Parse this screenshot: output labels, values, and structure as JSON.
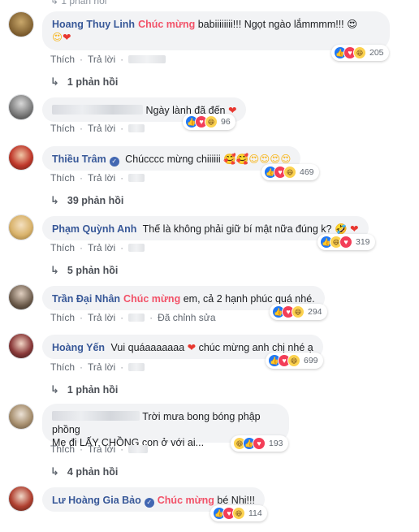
{
  "top_cut_text": "1 phản hồi",
  "action_labels": {
    "like": "Thích",
    "reply": "Trả lời",
    "edited": "Đã chỉnh sửa",
    "sep": "·"
  },
  "comments": [
    {
      "author": "Hoang Thuy Linh",
      "tag": "Chúc mừng",
      "text": "babiiiiiiii!!! Ngọt ngào lắmmmm!!! 😍",
      "text2": "😍",
      "heart": "❤",
      "reaction_count": "205",
      "replies": "1 phản hồi"
    },
    {
      "text": "Ngày lành đã đến",
      "heart": "❤",
      "reaction_count": "96"
    },
    {
      "author": "Thiều Trâm",
      "text": "Chúcccc mừng chiiiiii",
      "emojis": "🥰🥰😍😍😍😍",
      "reaction_count": "469",
      "replies": "39 phản hồi"
    },
    {
      "author": "Phạm Quỳnh Anh",
      "text": "Thế là không phải giữ bí mật nữa đúng k? 🤣",
      "heart": "❤",
      "reaction_count": "319",
      "replies": "5 phản hồi"
    },
    {
      "author": "Trần Đại Nhân",
      "tag": "Chúc mừng",
      "text": "em, cả 2 hạnh phúc quá nhé.",
      "reaction_count": "294"
    },
    {
      "author": "Hoàng Yến",
      "text": "Vui quáaaaaaaa",
      "heart": "❤",
      "text_after": "chúc mừng anh chị nhé ạ",
      "reaction_count": "699",
      "replies": "1 phản hồi"
    },
    {
      "text": "Trời mưa bong bóng phập phồng",
      "text_line2": "Mẹ đi LẤY CHỒNG con ở với ai...",
      "reaction_count": "193",
      "replies": "4 phản hồi"
    },
    {
      "author": "Lư Hoàng Gia Bảo",
      "tag": "Chúc mừng",
      "text": "bé Nhi!!!",
      "reaction_count": "114"
    }
  ],
  "colors": {
    "author": "#385898",
    "tag": "#f25268",
    "bubble": "#f2f3f5",
    "like": "#2078f4",
    "love": "#f33e58",
    "haha": "#fcd24f"
  },
  "icons": [
    "reply-arrow-icon",
    "like-reaction-icon",
    "love-reaction-icon",
    "haha-reaction-icon",
    "verified-badge-icon",
    "heart-icon"
  ]
}
